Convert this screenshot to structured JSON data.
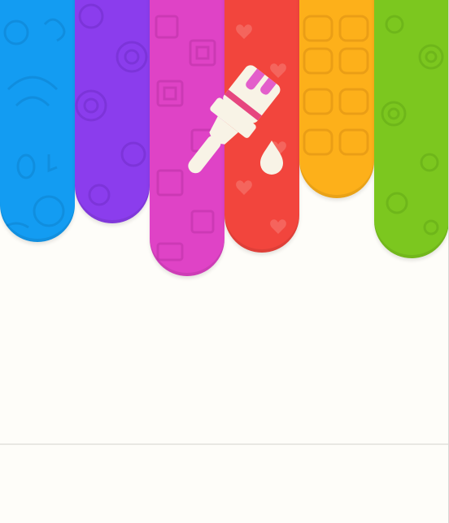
{
  "theme": {
    "background": "#fefdf9",
    "icon_color": "#f8f3e6"
  },
  "stripes": [
    {
      "name": "blue",
      "color": "#139cf2",
      "pattern": "doodles"
    },
    {
      "name": "purple",
      "color": "#8b3ded",
      "pattern": "circles"
    },
    {
      "name": "pink",
      "color": "#df43c6",
      "pattern": "squares"
    },
    {
      "name": "red",
      "color": "#f2453d",
      "pattern": "hearts"
    },
    {
      "name": "orange",
      "color": "#fdb01a",
      "pattern": "rounded-squares"
    },
    {
      "name": "green",
      "color": "#7cc71f",
      "pattern": "flowers"
    }
  ],
  "icons": {
    "hero": "paintbrush-icon",
    "drop": "paint-drop-icon"
  }
}
